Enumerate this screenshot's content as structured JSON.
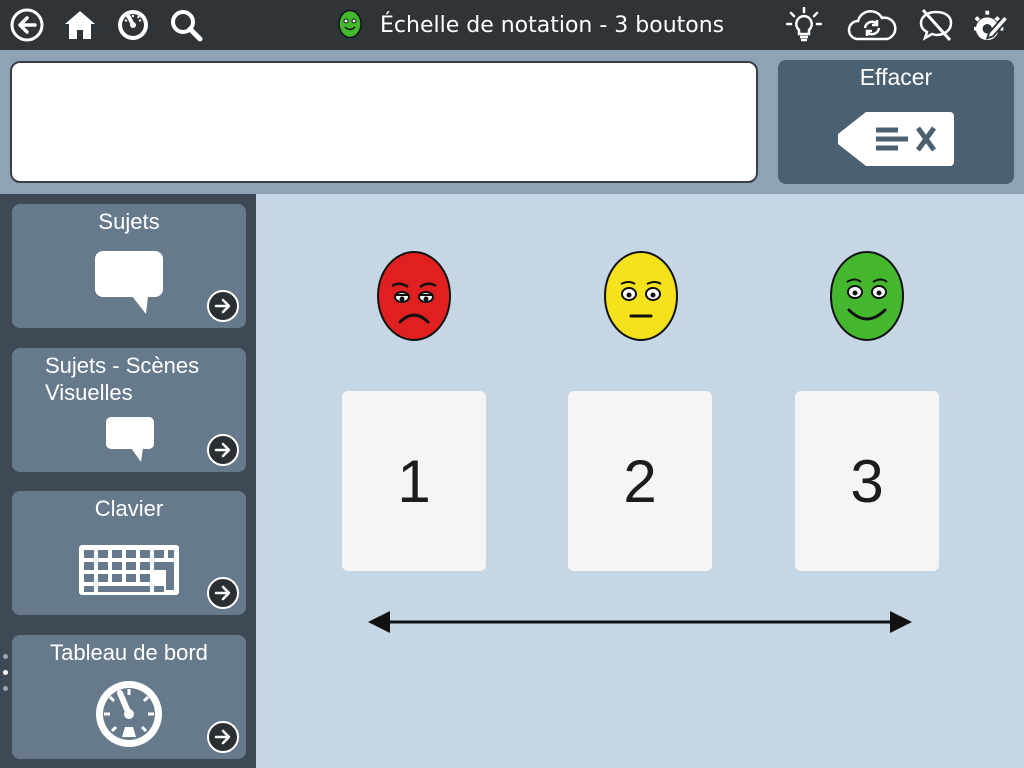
{
  "header": {
    "title": "Échelle de notation - 3 boutons",
    "icons": {
      "back": "back-arrow-icon",
      "home": "home-icon",
      "dashboard": "dashboard-icon",
      "search": "search-icon",
      "title_face": "green-egg-face-icon",
      "lightbulb": "lightbulb-icon",
      "sync": "cloud-sync-icon",
      "speech_off": "speech-off-icon",
      "edit": "edit-pencil-icon"
    }
  },
  "message_bar": {
    "text": "",
    "clear_label": "Effacer"
  },
  "sidebar": {
    "items": [
      {
        "label": "Sujets",
        "icon": "speech-bubble-icon"
      },
      {
        "label": "Sujets - Scènes Visuelles",
        "icon": "speech-bubble-small-icon"
      },
      {
        "label": "Clavier",
        "icon": "keyboard-icon"
      },
      {
        "label": "Tableau de bord",
        "icon": "dashboard-gauge-icon"
      }
    ],
    "page_dots": 3,
    "active_dot": 1
  },
  "main": {
    "faces": [
      {
        "mood": "sad",
        "color": "#e02020"
      },
      {
        "mood": "neutral",
        "color": "#f5e21b"
      },
      {
        "mood": "happy",
        "color": "#45b72f"
      }
    ],
    "buttons": [
      {
        "label": "1"
      },
      {
        "label": "2"
      },
      {
        "label": "3"
      }
    ]
  },
  "colors": {
    "topbar": "#2f3438",
    "sidebar": "#3d4a55",
    "sidebar_item": "#677a8b",
    "main_bg": "#c5d6e4",
    "message_bar": "#8fa3b6",
    "clear_button": "#4b6071"
  }
}
